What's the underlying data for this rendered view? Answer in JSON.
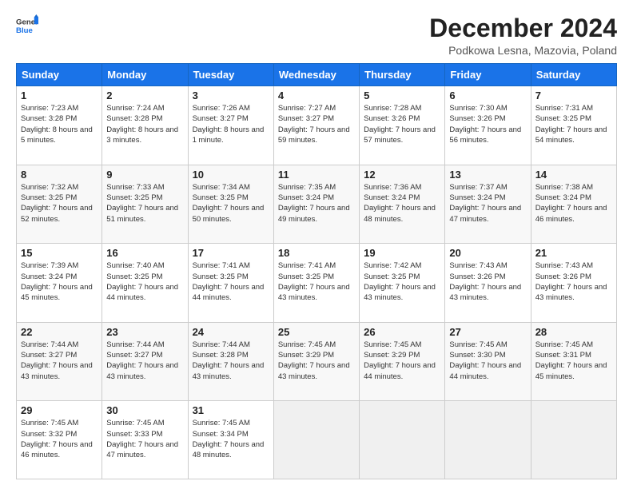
{
  "logo": {
    "line1": "General",
    "line2": "Blue"
  },
  "title": "December 2024",
  "subtitle": "Podkowa Lesna, Mazovia, Poland",
  "headers": [
    "Sunday",
    "Monday",
    "Tuesday",
    "Wednesday",
    "Thursday",
    "Friday",
    "Saturday"
  ],
  "weeks": [
    [
      {
        "day": "1",
        "info": "Sunrise: 7:23 AM\nSunset: 3:28 PM\nDaylight: 8 hours\nand 5 minutes."
      },
      {
        "day": "2",
        "info": "Sunrise: 7:24 AM\nSunset: 3:28 PM\nDaylight: 8 hours\nand 3 minutes."
      },
      {
        "day": "3",
        "info": "Sunrise: 7:26 AM\nSunset: 3:27 PM\nDaylight: 8 hours\nand 1 minute."
      },
      {
        "day": "4",
        "info": "Sunrise: 7:27 AM\nSunset: 3:27 PM\nDaylight: 7 hours\nand 59 minutes."
      },
      {
        "day": "5",
        "info": "Sunrise: 7:28 AM\nSunset: 3:26 PM\nDaylight: 7 hours\nand 57 minutes."
      },
      {
        "day": "6",
        "info": "Sunrise: 7:30 AM\nSunset: 3:26 PM\nDaylight: 7 hours\nand 56 minutes."
      },
      {
        "day": "7",
        "info": "Sunrise: 7:31 AM\nSunset: 3:25 PM\nDaylight: 7 hours\nand 54 minutes."
      }
    ],
    [
      {
        "day": "8",
        "info": "Sunrise: 7:32 AM\nSunset: 3:25 PM\nDaylight: 7 hours\nand 52 minutes."
      },
      {
        "day": "9",
        "info": "Sunrise: 7:33 AM\nSunset: 3:25 PM\nDaylight: 7 hours\nand 51 minutes."
      },
      {
        "day": "10",
        "info": "Sunrise: 7:34 AM\nSunset: 3:25 PM\nDaylight: 7 hours\nand 50 minutes."
      },
      {
        "day": "11",
        "info": "Sunrise: 7:35 AM\nSunset: 3:24 PM\nDaylight: 7 hours\nand 49 minutes."
      },
      {
        "day": "12",
        "info": "Sunrise: 7:36 AM\nSunset: 3:24 PM\nDaylight: 7 hours\nand 48 minutes."
      },
      {
        "day": "13",
        "info": "Sunrise: 7:37 AM\nSunset: 3:24 PM\nDaylight: 7 hours\nand 47 minutes."
      },
      {
        "day": "14",
        "info": "Sunrise: 7:38 AM\nSunset: 3:24 PM\nDaylight: 7 hours\nand 46 minutes."
      }
    ],
    [
      {
        "day": "15",
        "info": "Sunrise: 7:39 AM\nSunset: 3:24 PM\nDaylight: 7 hours\nand 45 minutes."
      },
      {
        "day": "16",
        "info": "Sunrise: 7:40 AM\nSunset: 3:25 PM\nDaylight: 7 hours\nand 44 minutes."
      },
      {
        "day": "17",
        "info": "Sunrise: 7:41 AM\nSunset: 3:25 PM\nDaylight: 7 hours\nand 44 minutes."
      },
      {
        "day": "18",
        "info": "Sunrise: 7:41 AM\nSunset: 3:25 PM\nDaylight: 7 hours\nand 43 minutes."
      },
      {
        "day": "19",
        "info": "Sunrise: 7:42 AM\nSunset: 3:25 PM\nDaylight: 7 hours\nand 43 minutes."
      },
      {
        "day": "20",
        "info": "Sunrise: 7:43 AM\nSunset: 3:26 PM\nDaylight: 7 hours\nand 43 minutes."
      },
      {
        "day": "21",
        "info": "Sunrise: 7:43 AM\nSunset: 3:26 PM\nDaylight: 7 hours\nand 43 minutes."
      }
    ],
    [
      {
        "day": "22",
        "info": "Sunrise: 7:44 AM\nSunset: 3:27 PM\nDaylight: 7 hours\nand 43 minutes."
      },
      {
        "day": "23",
        "info": "Sunrise: 7:44 AM\nSunset: 3:27 PM\nDaylight: 7 hours\nand 43 minutes."
      },
      {
        "day": "24",
        "info": "Sunrise: 7:44 AM\nSunset: 3:28 PM\nDaylight: 7 hours\nand 43 minutes."
      },
      {
        "day": "25",
        "info": "Sunrise: 7:45 AM\nSunset: 3:29 PM\nDaylight: 7 hours\nand 43 minutes."
      },
      {
        "day": "26",
        "info": "Sunrise: 7:45 AM\nSunset: 3:29 PM\nDaylight: 7 hours\nand 44 minutes."
      },
      {
        "day": "27",
        "info": "Sunrise: 7:45 AM\nSunset: 3:30 PM\nDaylight: 7 hours\nand 44 minutes."
      },
      {
        "day": "28",
        "info": "Sunrise: 7:45 AM\nSunset: 3:31 PM\nDaylight: 7 hours\nand 45 minutes."
      }
    ],
    [
      {
        "day": "29",
        "info": "Sunrise: 7:45 AM\nSunset: 3:32 PM\nDaylight: 7 hours\nand 46 minutes."
      },
      {
        "day": "30",
        "info": "Sunrise: 7:45 AM\nSunset: 3:33 PM\nDaylight: 7 hours\nand 47 minutes."
      },
      {
        "day": "31",
        "info": "Sunrise: 7:45 AM\nSunset: 3:34 PM\nDaylight: 7 hours\nand 48 minutes."
      },
      {
        "day": "",
        "info": ""
      },
      {
        "day": "",
        "info": ""
      },
      {
        "day": "",
        "info": ""
      },
      {
        "day": "",
        "info": ""
      }
    ]
  ]
}
